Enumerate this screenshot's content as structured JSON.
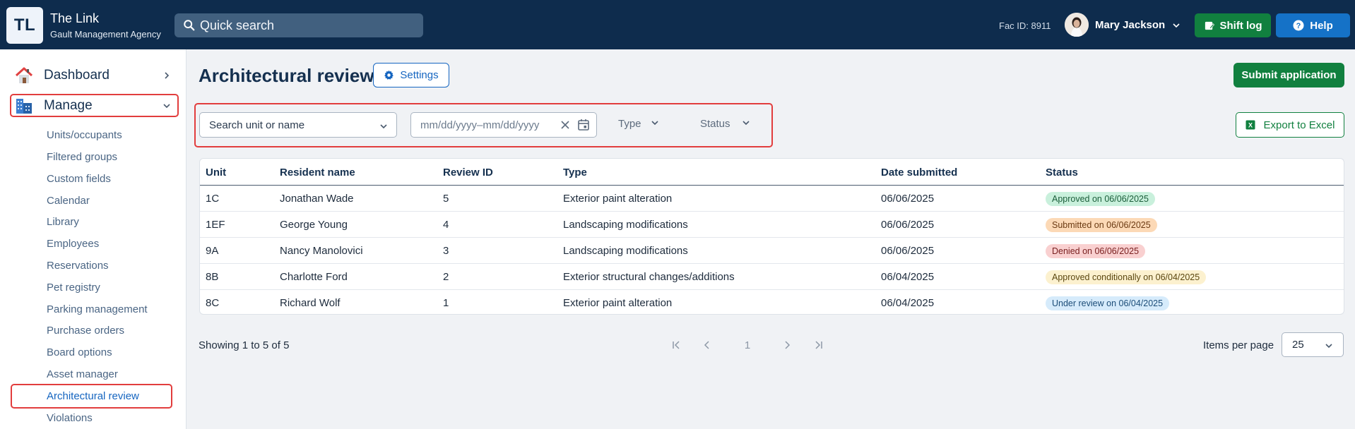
{
  "app": {
    "logo": "TL",
    "name": "The Link",
    "agency": "Gault Management Agency"
  },
  "header": {
    "search_placeholder": "Quick search",
    "fac_id": "Fac ID: 8911",
    "user_name": "Mary Jackson",
    "shift_log": "Shift log",
    "help": "Help"
  },
  "sidebar": {
    "dashboard": "Dashboard",
    "manage": "Manage",
    "items": [
      "Units/occupants",
      "Filtered groups",
      "Custom fields",
      "Calendar",
      "Library",
      "Employees",
      "Reservations",
      "Pet registry",
      "Parking management",
      "Purchase orders",
      "Board options",
      "Asset manager",
      "Architectural review",
      "Violations"
    ],
    "active_item": "Architectural review"
  },
  "page": {
    "title": "Architectural review",
    "settings": "Settings",
    "submit": "Submit application",
    "export": "Export to Excel"
  },
  "filters": {
    "unit_placeholder": "Search unit or name",
    "date_placeholder": "mm/dd/yyyy–mm/dd/yyyy",
    "type": "Type",
    "status": "Status"
  },
  "table": {
    "headers": [
      "Unit",
      "Resident name",
      "Review ID",
      "Type",
      "Date submitted",
      "Status"
    ],
    "rows": [
      {
        "unit": "1C",
        "name": "Jonathan Wade",
        "id": "5",
        "type": "Exterior paint alteration",
        "date": "06/06/2025",
        "status": "Approved on 06/06/2025",
        "status_kind": "approved"
      },
      {
        "unit": "1EF",
        "name": "George Young",
        "id": "4",
        "type": "Landscaping modifications",
        "date": "06/06/2025",
        "status": "Submitted on 06/06/2025",
        "status_kind": "submitted"
      },
      {
        "unit": "9A",
        "name": "Nancy Manolovici",
        "id": "3",
        "type": "Landscaping modifications",
        "date": "06/06/2025",
        "status": "Denied on 06/06/2025",
        "status_kind": "denied"
      },
      {
        "unit": "8B",
        "name": "Charlotte Ford",
        "id": "2",
        "type": "Exterior structural changes/additions",
        "date": "06/04/2025",
        "status": "Approved conditionally on 06/04/2025",
        "status_kind": "conditional"
      },
      {
        "unit": "8C",
        "name": "Richard Wolf",
        "id": "1",
        "type": "Exterior paint alteration",
        "date": "06/04/2025",
        "status": "Under review on 06/04/2025",
        "status_kind": "review"
      }
    ]
  },
  "pagination": {
    "showing": "Showing 1 to 5 of 5",
    "current_page": "1",
    "items_per_page_label": "Items per page",
    "items_per_page": "25"
  },
  "colors": {
    "header_bg": "#0e2c4d",
    "primary": "#1565c0",
    "success": "#11803f",
    "highlight": "#e23d3d",
    "badge_approved": "#c9f0dc",
    "badge_submitted": "#fcd9b6",
    "badge_denied": "#f9d0d0",
    "badge_conditional": "#fcf1cf",
    "badge_review": "#d6ebfb"
  }
}
